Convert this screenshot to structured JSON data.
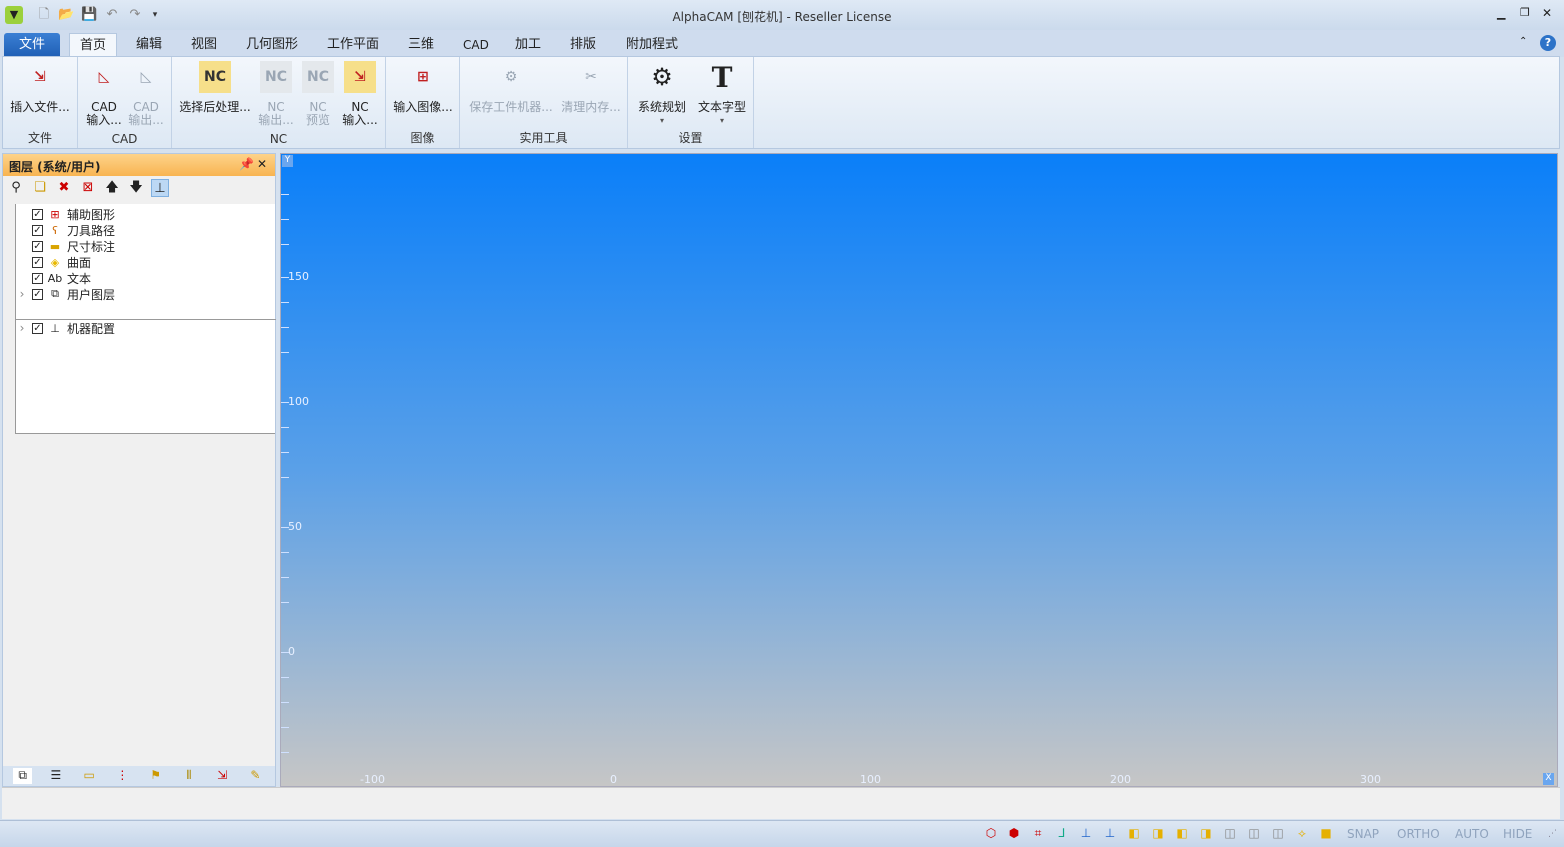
{
  "window": {
    "title": "AlphaCAM [刨花机] - Reseller License"
  },
  "tabs": [
    "文件",
    "首页",
    "编辑",
    "视图",
    "几何图形",
    "工作平面",
    "三维",
    "CAD",
    "加工",
    "排版",
    "附加程式"
  ],
  "ribbon": {
    "groups": [
      {
        "label": "文件",
        "buttons": [
          {
            "l1": "插入文件...",
            "l2": ""
          }
        ]
      },
      {
        "label": "CAD",
        "buttons": [
          {
            "l1": "CAD",
            "l2": "输入..."
          },
          {
            "l1": "CAD",
            "l2": "输出..."
          }
        ]
      },
      {
        "label": "NC",
        "buttons": [
          {
            "l1": "选择后处理...",
            "l2": ""
          },
          {
            "l1": "NC",
            "l2": "输出..."
          },
          {
            "l1": "NC",
            "l2": "预览"
          },
          {
            "l1": "NC",
            "l2": "输入..."
          }
        ]
      },
      {
        "label": "图像",
        "buttons": [
          {
            "l1": "输入图像...",
            "l2": ""
          }
        ]
      },
      {
        "label": "实用工具",
        "buttons": [
          {
            "l1": "保存工件机器...",
            "l2": ""
          },
          {
            "l1": "清理内存...",
            "l2": ""
          }
        ]
      },
      {
        "label": "设置",
        "buttons": [
          {
            "l1": "系统规划",
            "l2": "▾"
          },
          {
            "l1": "文本字型",
            "l2": "▾"
          }
        ]
      }
    ]
  },
  "panel": {
    "title": "图层 (系统/用户)",
    "items": [
      "辅助图形",
      "刀具路径",
      "尺寸标注",
      "曲面",
      "文本",
      "用户图层"
    ],
    "text_icon": "Ab",
    "machine": "机器配置"
  },
  "viewport": {
    "y_axis_label": "Y",
    "x_axis_label": "X",
    "y_ticks": [
      "150",
      "100",
      "50",
      "0"
    ],
    "x_ticks": [
      "-100",
      "0",
      "100",
      "200",
      "300"
    ]
  },
  "status": {
    "snap": "SNAP",
    "ortho": "ORTHO",
    "auto": "AUTO",
    "hide": "HIDE"
  },
  "colors": {
    "accent": "#1f5fb5",
    "panel_header": "#f8b451",
    "viewport_top": "#0a7ff9",
    "viewport_bottom": "#c6c6c6"
  }
}
